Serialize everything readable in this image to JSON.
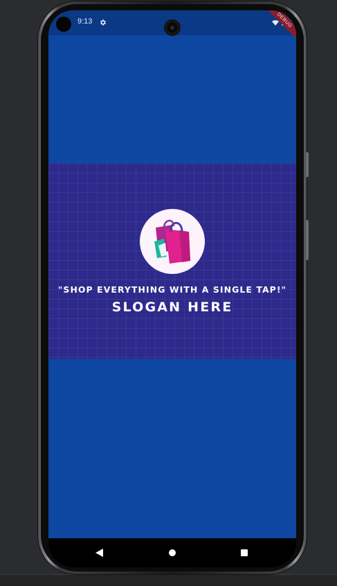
{
  "status_bar": {
    "time": "9:13",
    "settings_icon": "gear-icon",
    "wifi_icon": "wifi-icon",
    "battery_icon": "battery-icon"
  },
  "debug_banner": "DEBUG",
  "splash": {
    "logo_icon": "shopping-bag-icon",
    "tagline": "\"SHOP EVERYTHING WITH A SINGLE TAP!\"",
    "slogan": "SLOGAN HERE"
  },
  "navigation": {
    "back_icon": "back-triangle-icon",
    "home_icon": "home-circle-icon",
    "recents_icon": "recents-square-icon"
  },
  "colors": {
    "screen_background": "#0d47a1",
    "status_bar": "#0a3a86",
    "banner_background": "#2d2a8c",
    "logo_circle": "#fdf3fa",
    "bag_magenta": "#d81b8c",
    "debug_ribbon": "#8b1d2c"
  }
}
